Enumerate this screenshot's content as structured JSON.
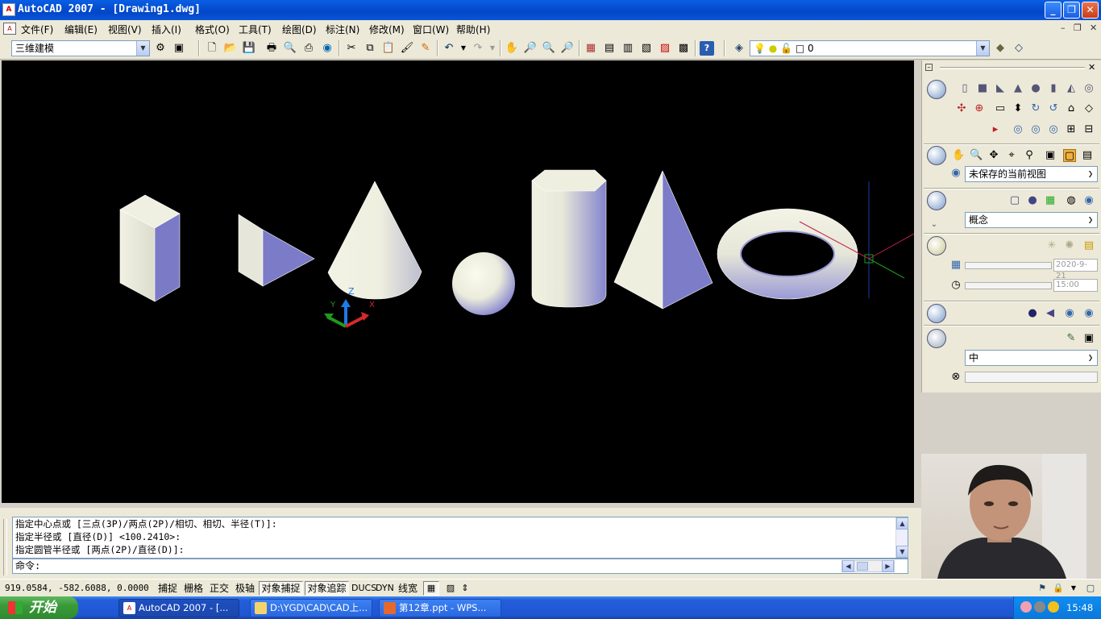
{
  "window": {
    "title": "AutoCAD 2007 - [Drawing1.dwg]",
    "app_icon": "autocad-icon"
  },
  "caption_buttons": {
    "minimize": "_",
    "restore": "❐",
    "close": "✕"
  },
  "menu": {
    "items": [
      "文件(F)",
      "编辑(E)",
      "视图(V)",
      "插入(I)",
      "格式(O)",
      "工具(T)",
      "绘图(D)",
      "标注(N)",
      "修改(M)",
      "窗口(W)",
      "帮助(H)"
    ],
    "mdi_controls": {
      "minimize": "–",
      "restore": "❐",
      "close": "✕"
    }
  },
  "toolbar": {
    "workspace": "三维建模",
    "layer": "0"
  },
  "viewport": {
    "background": "#000000",
    "objects": [
      "box",
      "wedge",
      "cone",
      "sphere",
      "cylinder",
      "pyramid",
      "torus"
    ],
    "ucs": {
      "x": "X",
      "y": "Y",
      "z": "Z"
    }
  },
  "dashboard": {
    "view_select": "未保存的当前视图",
    "visual_style": "概念",
    "date_value": "2020-9-21",
    "time_value": "15:00",
    "quality": "中"
  },
  "command": {
    "history": [
      "指定中心点或 [三点(3P)/两点(2P)/相切、相切、半径(T)]:",
      "指定半径或 [直径(D)] <100.2410>:",
      "指定圆管半径或 [两点(2P)/直径(D)]:"
    ],
    "prompt": "命令:"
  },
  "status": {
    "coords": "919.0584,  -582.6088, 0.0000",
    "toggles": [
      {
        "label": "捕捉",
        "on": false
      },
      {
        "label": "栅格",
        "on": false
      },
      {
        "label": "正交",
        "on": false
      },
      {
        "label": "极轴",
        "on": false
      },
      {
        "label": "对象捕捉",
        "on": true
      },
      {
        "label": "对象追踪",
        "on": true
      },
      {
        "label": "DUCS",
        "on": false
      },
      {
        "label": "DYN",
        "on": false
      },
      {
        "label": "线宽",
        "on": false
      }
    ]
  },
  "taskbar": {
    "start": "开始",
    "tasks": [
      "AutoCAD 2007 - [...",
      "D:\\YGD\\CAD\\CAD上...",
      "第12章.ppt - WPS..."
    ],
    "clock": "15:48"
  },
  "colors": {
    "title_blue": "#0a5fe4",
    "solid_face_light": "#eeeedf",
    "solid_face_blue": "#7b7bc8",
    "taskbar": "#245edb",
    "start_green": "#3a9a3a"
  }
}
